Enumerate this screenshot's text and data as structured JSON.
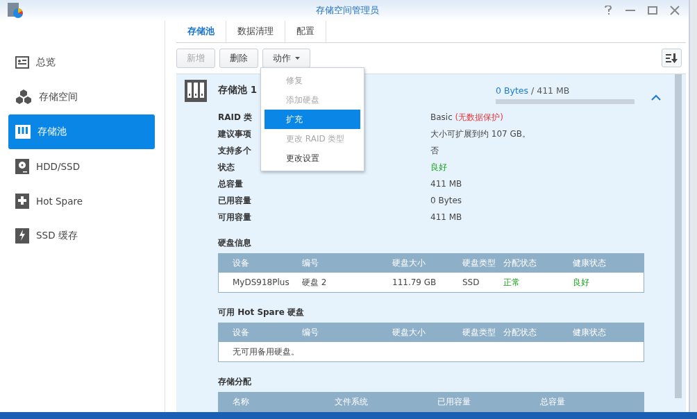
{
  "window": {
    "title": "存储空间管理员"
  },
  "sidebar": {
    "items": [
      {
        "label": "总览",
        "selected": false
      },
      {
        "label": "存储空间",
        "selected": false
      },
      {
        "label": "存储池",
        "selected": true
      },
      {
        "label": "HDD/SSD",
        "selected": false
      },
      {
        "label": "Hot Spare",
        "selected": false
      },
      {
        "label": "SSD 缓存",
        "selected": false
      }
    ]
  },
  "tabs": [
    {
      "label": "存储池",
      "selected": true
    },
    {
      "label": "数据清理",
      "selected": false
    },
    {
      "label": "配置",
      "selected": false
    }
  ],
  "toolbar": {
    "buttons": [
      {
        "label": "新增",
        "disabled": true,
        "kind": "plain"
      },
      {
        "label": "删除",
        "disabled": false,
        "kind": "plain"
      },
      {
        "label": "动作",
        "disabled": false,
        "kind": "dropdown"
      }
    ]
  },
  "action_menu": {
    "items": [
      {
        "label": "修复",
        "disabled": true,
        "selected": false
      },
      {
        "label": "添加硬盘",
        "disabled": true,
        "selected": false
      },
      {
        "label": "扩充",
        "disabled": false,
        "selected": true
      },
      {
        "label": "更改 RAID 类型",
        "disabled": true,
        "selected": false
      },
      {
        "label": "更改设置",
        "disabled": false,
        "selected": false
      }
    ]
  },
  "pool": {
    "name": "存储池 1",
    "used": "0 Bytes",
    "total": "/ 411 MB",
    "level": 0,
    "expanded": true,
    "info": [
      {
        "label": "RAID 类",
        "value": "Basic",
        "note": "(无数据保护)",
        "kind": "plain"
      },
      {
        "label": "建议事项",
        "value": "大小可扩展到约 107 GB。",
        "kind": "plain"
      },
      {
        "label": "支持多个",
        "value": "否",
        "kind": "plain"
      },
      {
        "label": "状态",
        "value": "良好",
        "kind": "status"
      },
      {
        "label": "总容量",
        "value": "411 MB",
        "kind": "plain"
      },
      {
        "label": "已用容量",
        "value": "0 Bytes",
        "kind": "plain"
      },
      {
        "label": "可用容量",
        "value": "411 MB",
        "kind": "plain"
      }
    ],
    "sections": [
      {
        "title": "硬盘信息",
        "columns": [
          "设备",
          "编号",
          "硬盘大小",
          "硬盘类型",
          "分配状态",
          "健康状态"
        ],
        "rows": [
          [
            {
              "text": "MyDS918Plus",
              "kind": "plain"
            },
            {
              "text": "硬盘 2",
              "kind": "plain"
            },
            {
              "text": "111.79 GB",
              "kind": "plain"
            },
            {
              "text": "SSD",
              "kind": "plain"
            },
            {
              "text": "正常",
              "kind": "status"
            },
            {
              "text": "良好",
              "kind": "status"
            }
          ]
        ]
      },
      {
        "title": "可用 Hot Spare 硬盘",
        "columns": [
          "设备",
          "编号",
          "硬盘大小",
          "硬盘类型",
          "分配状态",
          "健康状态"
        ],
        "empty": "无可用备用硬盘。"
      },
      {
        "title": "存储分配",
        "columns": [
          "名称",
          "文件系统",
          "已用容量",
          "总容量"
        ]
      }
    ]
  }
}
